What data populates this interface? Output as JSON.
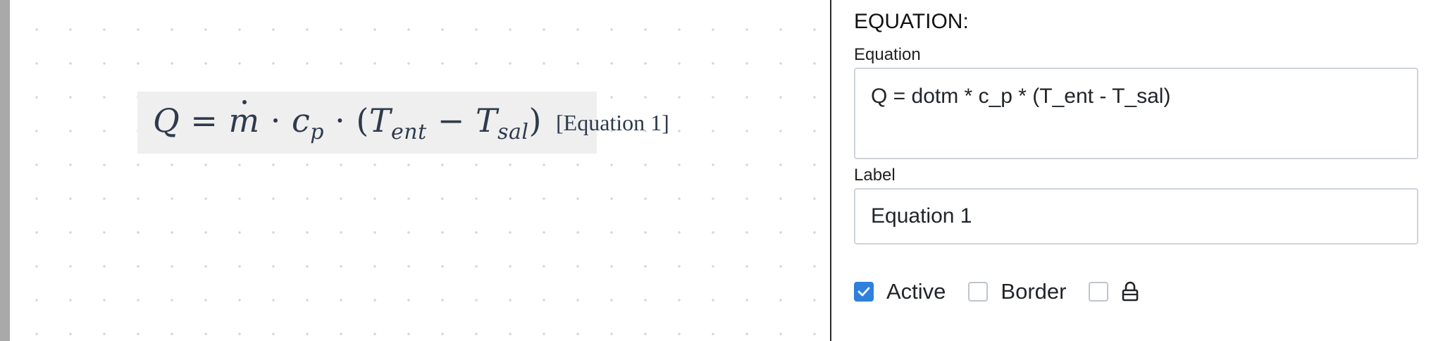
{
  "editor": {
    "equation_display": {
      "lhs": "Q",
      "equals": "=",
      "mdot": "m",
      "dot1": "·",
      "c": "c",
      "c_sub": "p",
      "dot2": "·",
      "paren_open": "(",
      "T1": "T",
      "T1_sub": "ent",
      "minus": "−",
      "T2": "T",
      "T2_sub": "sal",
      "paren_close": ")",
      "tag": "[Equation 1]"
    }
  },
  "panel": {
    "title": "EQUATION:",
    "equation_label": "Equation",
    "equation_value": "Q = dotm * c_p * (T_ent - T_sal)",
    "label_label": "Label",
    "label_value": "Equation 1",
    "checkboxes": [
      {
        "label": "Active",
        "checked": true
      },
      {
        "label": "Border",
        "checked": false
      },
      {
        "label": "",
        "checked": false,
        "icon": "lock-icon"
      }
    ]
  },
  "colors": {
    "accent": "#2f7fdd",
    "equation_text": "#2f3a4d",
    "equation_background": "#efefef"
  }
}
